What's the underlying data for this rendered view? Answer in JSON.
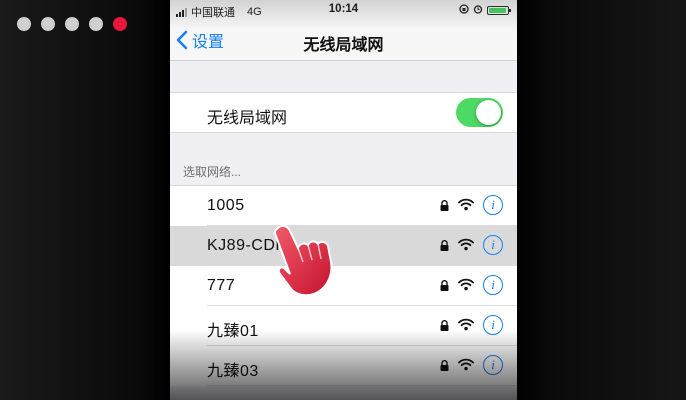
{
  "indicator": {
    "total": 5,
    "active_index": 4,
    "active_color": "#e8173e",
    "inactive_color": "#cfcfcf"
  },
  "status_bar": {
    "carrier": "中国联通",
    "network": "4G",
    "time": "10:14"
  },
  "nav": {
    "back_label": "设置",
    "title": "无线局域网"
  },
  "wifi_toggle": {
    "label": "无线局域网",
    "on": true,
    "on_color": "#4cd964"
  },
  "section_header": "选取网络...",
  "networks": [
    {
      "name": "1005",
      "locked": true,
      "selected": false
    },
    {
      "name": "KJ89-CDFF",
      "locked": true,
      "selected": true
    },
    {
      "name": "777",
      "locked": true,
      "selected": false
    },
    {
      "name": "九臻01",
      "locked": true,
      "selected": false
    },
    {
      "name": "九臻03",
      "locked": true,
      "selected": false
    }
  ],
  "accent_color": "#147efb",
  "icons": {
    "lock": "lock-icon",
    "wifi": "wifi-icon",
    "info": "info-icon",
    "pointer": "hand-pointer-icon"
  }
}
